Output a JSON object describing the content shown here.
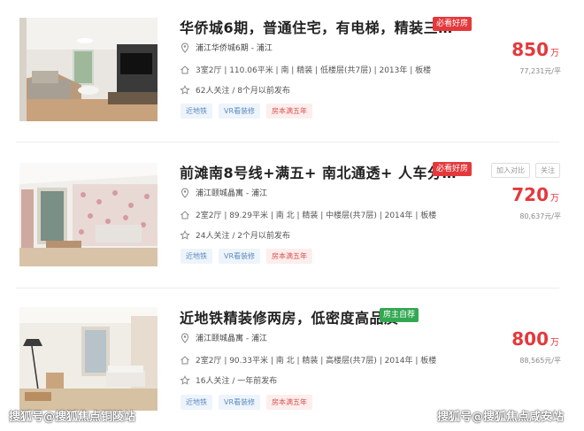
{
  "listings": [
    {
      "title": "华侨城6期，普通住宅，有电梯，精装三…",
      "badge": "必看好房",
      "badge_color": "#e4393c",
      "location": "浦江华侨城6期 - 浦江",
      "details": "3室2厅 | 110.06平米 | 南 | 精装 | 低楼层(共7层) | 2013年 | 板楼",
      "followers": "62人关注 / 8个月以前发布",
      "tags": [
        "近地铁",
        "VR看装修",
        "房本满五年"
      ],
      "price_value": "850",
      "price_unit": "万",
      "unit_price": "77,231元/平",
      "actions": []
    },
    {
      "title": "前滩南8号线+满五+ 南北通透+ 人车分…",
      "badge": "必看好房",
      "badge_color": "#e4393c",
      "location": "浦江颐城晶寓 - 浦江",
      "details": "2室2厅 | 89.29平米 | 南 北 | 精装 | 中楼层(共7层) | 2014年 | 板楼",
      "followers": "24人关注 / 2个月以前发布",
      "tags": [
        "近地铁",
        "VR看装修",
        "房本满五年"
      ],
      "price_value": "720",
      "price_unit": "万",
      "unit_price": "80,637元/平",
      "actions": [
        "加入对比",
        "关注"
      ]
    },
    {
      "title": "近地铁精装修两房，低密度高品质",
      "badge": "房主自荐",
      "badge_color": "#33a852",
      "location": "浦江颐城晶寓 - 浦江",
      "details": "2室2厅 | 90.33平米 | 南 北 | 精装 | 高楼层(共7层) | 2014年 | 板楼",
      "followers": "16人关注 / 一年前发布",
      "tags": [
        "近地铁",
        "VR看装修",
        "房本满五年"
      ],
      "price_value": "800",
      "price_unit": "万",
      "unit_price": "88,565元/平",
      "actions": []
    }
  ],
  "watermarks": [
    "搜狐号@搜狐焦点铜陵站",
    "搜狐号@搜狐焦点咸安站"
  ],
  "colors": {
    "price_red": "#e4393c",
    "tag_blue": "#5b8bbf",
    "tag_red": "#d9534f",
    "self_recommend_green": "#33a852"
  }
}
